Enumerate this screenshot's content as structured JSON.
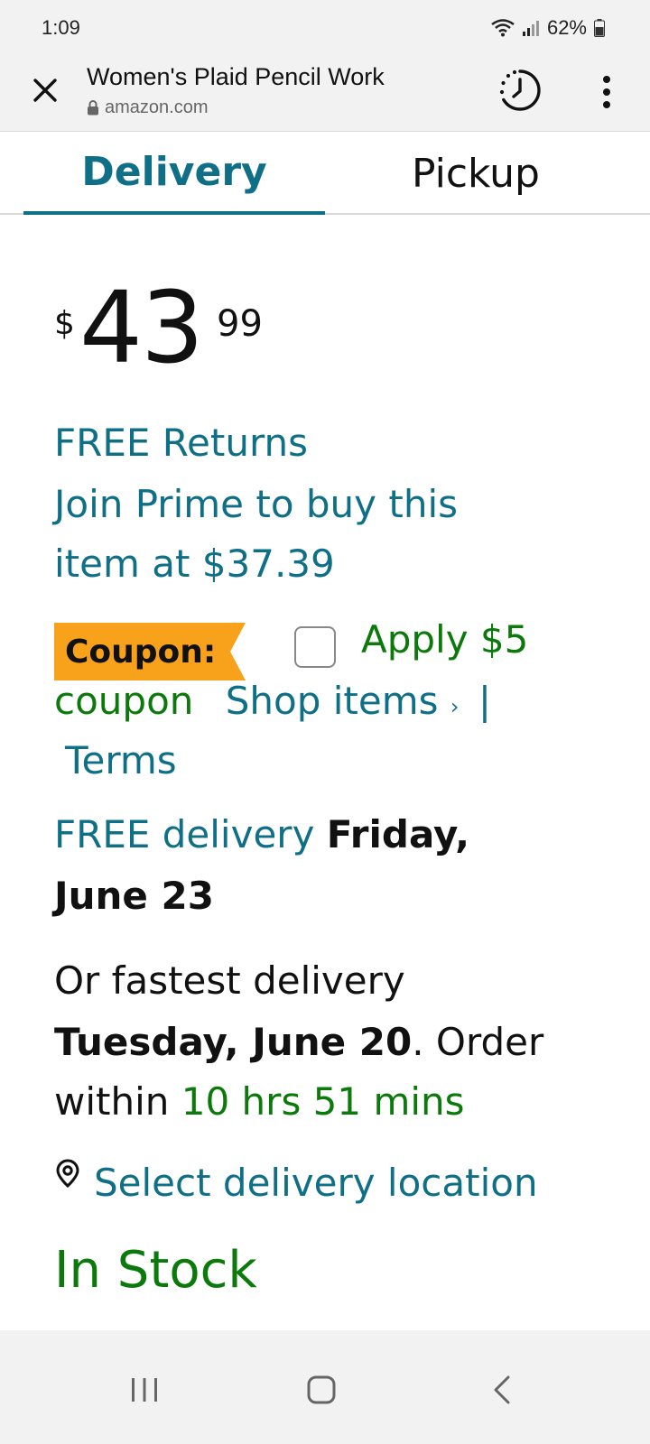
{
  "status_bar": {
    "time": "1:09",
    "battery": "62%"
  },
  "browser": {
    "title": "Women's Plaid Pencil Work",
    "url": "amazon.com"
  },
  "tabs": [
    {
      "label": "Delivery",
      "active": true
    },
    {
      "label": "Pickup",
      "active": false
    }
  ],
  "price": {
    "symbol": "$",
    "whole": "43",
    "fraction": "99"
  },
  "free_returns": "FREE Returns",
  "prime": {
    "line1": "Join Prime to buy this",
    "line2": "item at $37.39"
  },
  "coupon": {
    "badge": "Coupon:",
    "apply_a": "Apply $5",
    "apply_b": "coupon",
    "shop_items": "Shop items",
    "chevron": "›",
    "separator": "|",
    "terms": "Terms"
  },
  "delivery": {
    "free_label": "FREE delivery",
    "date_a": "Friday,",
    "date_b": "June 23"
  },
  "fastest": {
    "prefix": "Or fastest delivery",
    "date": "Tuesday, June 20",
    "suffix": ". Order",
    "within": "within",
    "countdown": "10 hrs 51 mins"
  },
  "location": {
    "label": "Select delivery location"
  },
  "stock": "In Stock",
  "colors": {
    "link": "#0f6f87",
    "green": "#0b7a0b",
    "coupon_badge": "#f7a21a"
  }
}
